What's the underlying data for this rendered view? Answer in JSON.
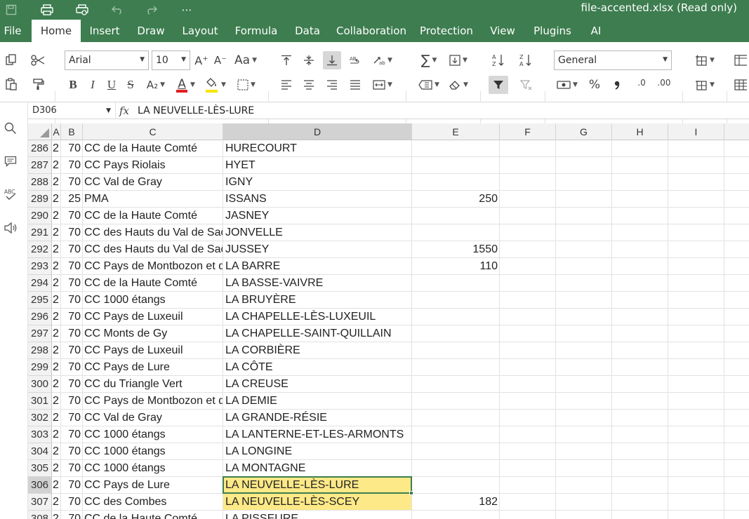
{
  "app": {
    "title": "file-accented.xlsx (Read only)",
    "accent": "#3d7d4f"
  },
  "quick_access": {
    "save": "save-icon",
    "print": "print-icon",
    "print_preview": "print-preview-icon",
    "undo": "undo-icon",
    "redo": "redo-icon",
    "more": "⋯"
  },
  "menu": {
    "items": [
      {
        "label": "File"
      },
      {
        "label": "Home"
      },
      {
        "label": "Insert"
      },
      {
        "label": "Draw"
      },
      {
        "label": "Layout"
      },
      {
        "label": "Formula"
      },
      {
        "label": "Data"
      },
      {
        "label": "Collaboration"
      },
      {
        "label": "Protection"
      },
      {
        "label": "View"
      },
      {
        "label": "Plugins"
      },
      {
        "label": "AI"
      }
    ],
    "active": "Home"
  },
  "ribbon": {
    "font_name": "Arial",
    "font_size": "10",
    "number_format": "General",
    "increase_font": "A⁺",
    "decrease_font": "A⁻",
    "change_case": "Aa",
    "bold": "B",
    "italic": "I",
    "underline": "U",
    "strikethrough": "S",
    "subscript": "A₂",
    "font_color": "A",
    "font_color_value": "#e02020",
    "fill_color_value": "#f5e500",
    "percent": "%",
    "sum": "∑",
    "inc_decimal": ".00",
    "dec_decimal": ".0",
    "sort_asc": "A↓Z",
    "sort_desc": "Z↓A"
  },
  "formula_bar": {
    "cell_ref": "D306",
    "fx": "fx",
    "content": "LA NEUVELLE-LÈS-LURE"
  },
  "columns": [
    "A",
    "B",
    "C",
    "D",
    "E",
    "F",
    "G",
    "H",
    "I"
  ],
  "active_column": "D",
  "active_row": "306",
  "rows": [
    {
      "num": "286",
      "a": "2",
      "b": "70",
      "c": "CC de la Haute Comté",
      "d": "HURECOURT",
      "e": ""
    },
    {
      "num": "287",
      "a": "2",
      "b": "70",
      "c": "CC Pays Riolais",
      "d": "HYET",
      "e": ""
    },
    {
      "num": "288",
      "a": "2",
      "b": "70",
      "c": "CC Val de Gray",
      "d": "IGNY",
      "e": ""
    },
    {
      "num": "289",
      "a": "2",
      "b": "25",
      "c": "PMA",
      "d": "ISSANS",
      "e": "250"
    },
    {
      "num": "290",
      "a": "2",
      "b": "70",
      "c": "CC de la Haute Comté",
      "d": "JASNEY",
      "e": ""
    },
    {
      "num": "291",
      "a": "2",
      "b": "70",
      "c": "CC des Hauts du Val de Saône",
      "d": "JONVELLE",
      "e": ""
    },
    {
      "num": "292",
      "a": "2",
      "b": "70",
      "c": "CC des Hauts du Val de Saône",
      "d": "JUSSEY",
      "e": "1550"
    },
    {
      "num": "293",
      "a": "2",
      "b": "70",
      "c": "CC Pays de Montbozon et du Chanois",
      "d": "LA BARRE",
      "e": "110"
    },
    {
      "num": "294",
      "a": "2",
      "b": "70",
      "c": "CC de la Haute Comté",
      "d": "LA BASSE-VAIVRE",
      "e": ""
    },
    {
      "num": "295",
      "a": "2",
      "b": "70",
      "c": "CC 1000 étangs",
      "d": "LA BRUYÈRE",
      "e": ""
    },
    {
      "num": "296",
      "a": "2",
      "b": "70",
      "c": "CC Pays de Luxeuil",
      "d": "LA CHAPELLE-LÈS-LUXEUIL",
      "e": ""
    },
    {
      "num": "297",
      "a": "2",
      "b": "70",
      "c": "CC Monts de Gy",
      "d": "LA CHAPELLE-SAINT-QUILLAIN",
      "e": ""
    },
    {
      "num": "298",
      "a": "2",
      "b": "70",
      "c": "CC Pays de Luxeuil",
      "d": "LA CORBIÈRE",
      "e": ""
    },
    {
      "num": "299",
      "a": "2",
      "b": "70",
      "c": "CC Pays de Lure",
      "d": "LA CÔTE",
      "e": ""
    },
    {
      "num": "300",
      "a": "2",
      "b": "70",
      "c": "CC du Triangle Vert",
      "d": "LA CREUSE",
      "e": ""
    },
    {
      "num": "301",
      "a": "2",
      "b": "70",
      "c": "CC Pays de Montbozon et du Chanois",
      "d": "LA DEMIE",
      "e": ""
    },
    {
      "num": "302",
      "a": "2",
      "b": "70",
      "c": "CC Val de Gray",
      "d": "LA GRANDE-RÉSIE",
      "e": ""
    },
    {
      "num": "303",
      "a": "2",
      "b": "70",
      "c": "CC 1000 étangs",
      "d": "LA LANTERNE-ET-LES-ARMONTS",
      "e": ""
    },
    {
      "num": "304",
      "a": "2",
      "b": "70",
      "c": "CC 1000 étangs",
      "d": "LA LONGINE",
      "e": ""
    },
    {
      "num": "305",
      "a": "2",
      "b": "70",
      "c": "CC 1000 étangs",
      "d": "LA MONTAGNE",
      "e": ""
    },
    {
      "num": "306",
      "a": "2",
      "b": "70",
      "c": "CC Pays de Lure",
      "d": "LA NEUVELLE-LÈS-LURE",
      "e": "",
      "highlight": true
    },
    {
      "num": "307",
      "a": "2",
      "b": "70",
      "c": "CC des Combes",
      "d": "LA NEUVELLE-LÈS-SCEY",
      "e": "182",
      "highlight": true
    },
    {
      "num": "308",
      "a": "2",
      "b": "70",
      "c": "CC de la Haute Comté",
      "d": "LA PISSEURE",
      "e": ""
    }
  ]
}
